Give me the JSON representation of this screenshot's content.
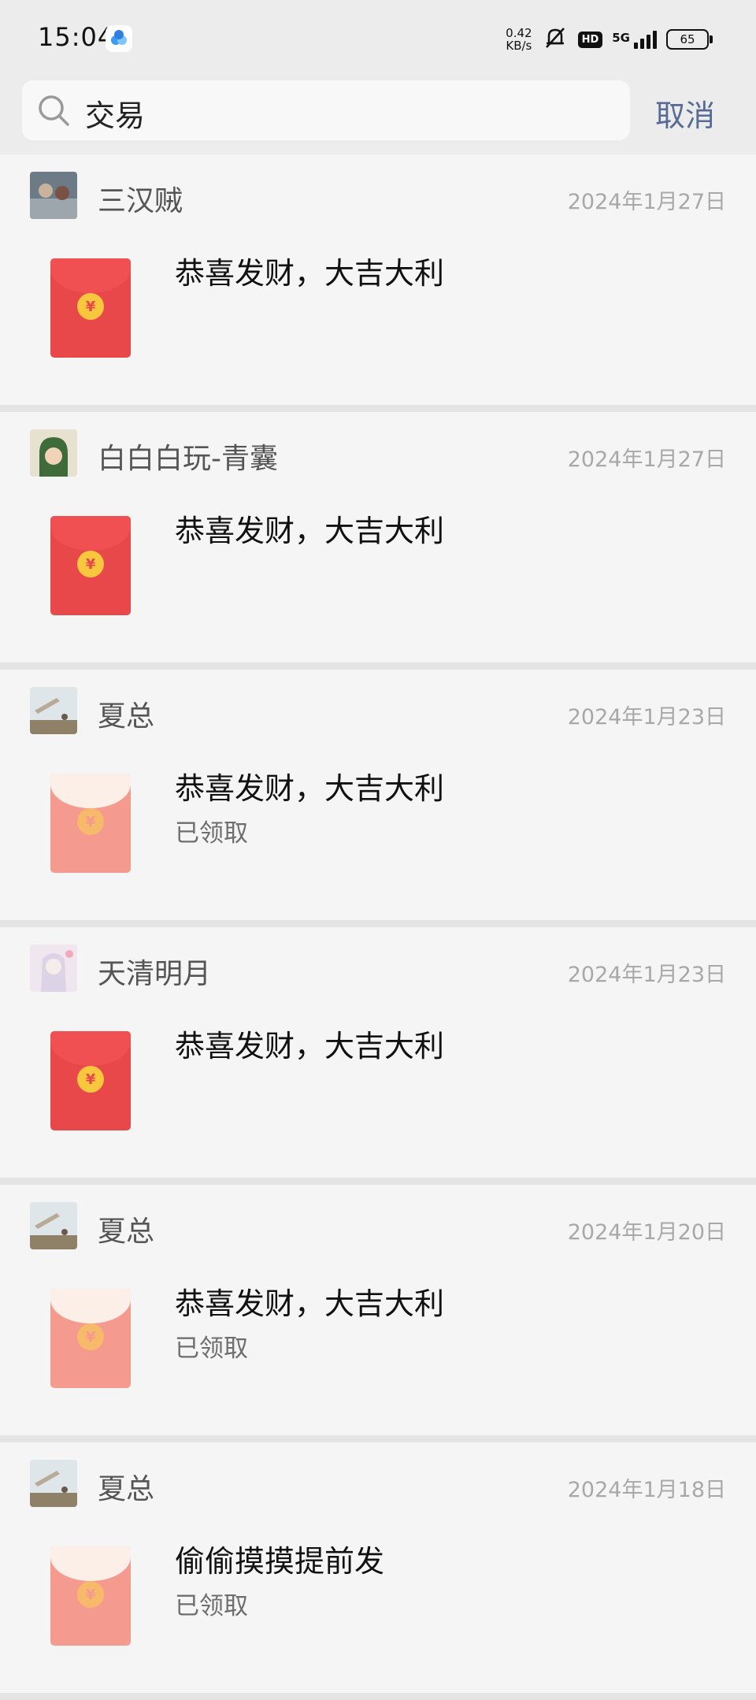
{
  "status_bar": {
    "time": "15:04",
    "speed_value": "0.42",
    "speed_unit": "KB/s",
    "hd": "HD",
    "network": "5G",
    "battery": "65"
  },
  "search": {
    "query": "交易",
    "cancel_label": "取消"
  },
  "results": [
    {
      "sender": "三汉贼",
      "date": "2024年1月27日",
      "message": "恭喜发财，大吉大利",
      "status": "",
      "claimed": false
    },
    {
      "sender": "白白白玩-青囊",
      "date": "2024年1月27日",
      "message": "恭喜发财，大吉大利",
      "status": "",
      "claimed": false
    },
    {
      "sender": "夏总",
      "date": "2024年1月23日",
      "message": "恭喜发财，大吉大利",
      "status": "已领取",
      "claimed": true
    },
    {
      "sender": "天清明月",
      "date": "2024年1月23日",
      "message": "恭喜发财，大吉大利",
      "status": "",
      "claimed": false
    },
    {
      "sender": "夏总",
      "date": "2024年1月20日",
      "message": "恭喜发财，大吉大利",
      "status": "已领取",
      "claimed": true
    },
    {
      "sender": "夏总",
      "date": "2024年1月18日",
      "message": "偷偷摸摸提前发",
      "status": "已领取",
      "claimed": true
    }
  ],
  "packet_coin_symbol": "¥",
  "colors": {
    "link": "#576b95",
    "packet_red": "#e8484a",
    "packet_claimed": "#f59a8f",
    "coin_gold": "#f9c73e"
  }
}
